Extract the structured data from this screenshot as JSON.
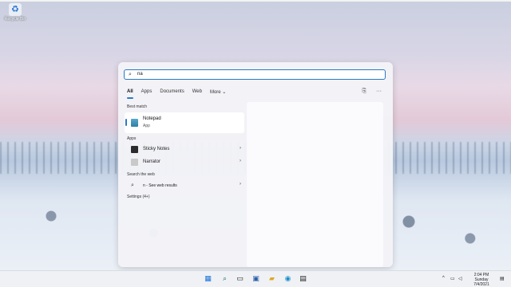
{
  "desktop": {
    "icon_label": "Recycle Bin",
    "icon_name": "recycle-bin-icon"
  },
  "search": {
    "value": "na",
    "icon_name": "search-icon"
  },
  "tabs": [
    "All",
    "Apps",
    "Documents",
    "Web",
    "More ⌄"
  ],
  "sections": {
    "best_match": "Best match",
    "apps": "Apps",
    "search_web": "Search the web",
    "settings": "Settings (4+)"
  },
  "best_match": {
    "title": "Notepad",
    "subtitle": "App",
    "icon_name": "notepad-icon"
  },
  "apps": [
    {
      "label": "Sticky Notes",
      "icon_name": "sticky-notes-icon",
      "color": "#2b2b2b"
    },
    {
      "label": "Narrator",
      "icon_name": "narrator-icon",
      "color": "#c9c9c9"
    }
  ],
  "web": {
    "label": "n - See web results",
    "icon_name": "search-icon"
  },
  "taskbar": {
    "items": [
      {
        "name": "start-icon",
        "glyph": "▦",
        "color": "#1a73d9"
      },
      {
        "name": "search-icon",
        "glyph": "⌕",
        "color": "#1b6f70"
      },
      {
        "name": "task-view-icon",
        "glyph": "▭",
        "color": "#222"
      },
      {
        "name": "widgets-icon",
        "glyph": "▣",
        "color": "#2b5fa8"
      },
      {
        "name": "file-explorer-icon",
        "glyph": "▰",
        "color": "#e0a81e"
      },
      {
        "name": "edge-icon",
        "glyph": "◉",
        "color": "#1a8ec9"
      },
      {
        "name": "store-icon",
        "glyph": "▤",
        "color": "#222"
      }
    ],
    "time": "2:04 PM",
    "day": "Sunday",
    "date": "7/4/2021"
  }
}
